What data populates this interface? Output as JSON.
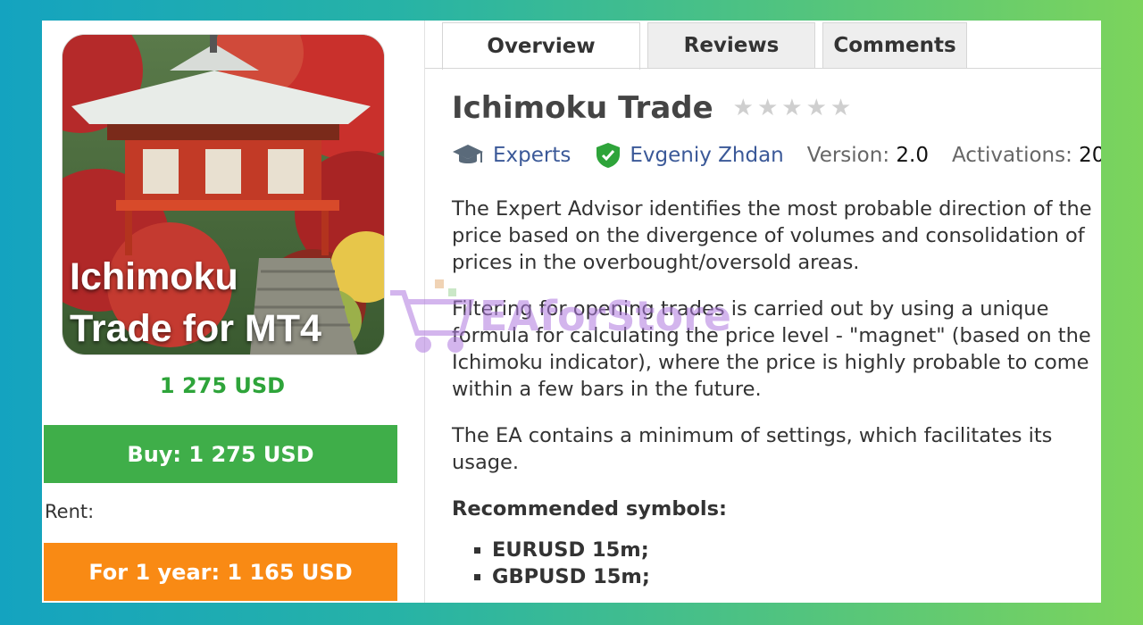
{
  "left": {
    "image_caption": "Ichimoku\nTrade for MT4",
    "price": "1 275 USD",
    "buy_label": "Buy: 1 275 USD",
    "rent_label": "Rent:",
    "rent_option": "For 1 year: 1 165 USD"
  },
  "tabs": [
    {
      "label": "Overview",
      "active": true
    },
    {
      "label": "Reviews",
      "active": false
    },
    {
      "label": "Comments",
      "active": false
    }
  ],
  "product": {
    "title": "Ichimoku Trade",
    "rating": 0,
    "rating_max": 5,
    "category": "Experts",
    "author": "Evgeniy Zhdan",
    "version_label": "Version:",
    "version": "2.0",
    "activations_label": "Activations:",
    "activations": "20"
  },
  "description": {
    "p1": "The Expert Advisor identifies the most probable direction of the price based on the divergence of volumes and consolidation of prices in the overbought/oversold areas.",
    "p2": "Filtering for opening trades is carried out by using a unique formula for calculating the price level - \"magnet\" (based on the Ichimoku indicator), where the price is highly probable to come within a few bars in the future.",
    "p3": "The EA contains a minimum of settings, which facilitates its usage.",
    "symbols_heading": "Recommended symbols:",
    "symbols": [
      "EURUSD 15m;",
      "GBPUSD 15m;"
    ]
  },
  "watermark": "EAforStore",
  "colors": {
    "price_green": "#2ea43a",
    "buy_green": "#3fae49",
    "rent_orange": "#f98a14",
    "link_blue": "#3b5998",
    "star_gray": "#cfcfcf"
  }
}
